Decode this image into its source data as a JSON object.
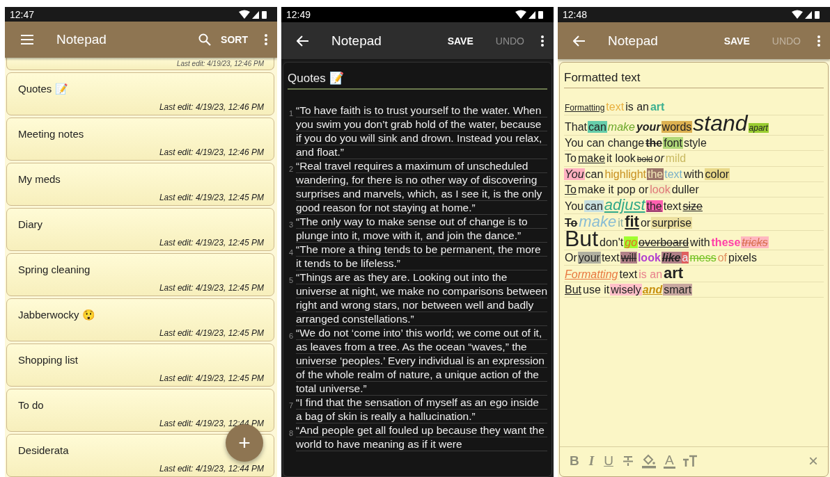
{
  "screens": [
    {
      "kind": "list",
      "time": "12:47",
      "title": "Notepad",
      "actions": [
        "SORT"
      ],
      "partial_note": {
        "date": "Last edit: 4/19/23, 12:46 PM"
      },
      "notes": [
        {
          "title": "Quotes 📝",
          "date": "Last edit: 4/19/23, 12:46 PM"
        },
        {
          "title": "Meeting notes",
          "date": "Last edit: 4/19/23, 12:46 PM"
        },
        {
          "title": "My meds",
          "date": "Last edit: 4/19/23, 12:45 PM"
        },
        {
          "title": "Diary",
          "date": "Last edit: 4/19/23, 12:45 PM"
        },
        {
          "title": "Spring cleaning",
          "date": "Last edit: 4/19/23, 12:45 PM"
        },
        {
          "title": "Jabberwocky 😲",
          "date": "Last edit: 4/19/23, 12:45 PM"
        },
        {
          "title": "Shopping list",
          "date": "Last edit: 4/19/23, 12:45 PM"
        },
        {
          "title": "To do",
          "date": "Last edit: 4/19/23, 12:44 PM"
        },
        {
          "title": "Desiderata",
          "date": "Last edit: 4/19/23, 12:44 PM"
        }
      ],
      "fab": "+"
    },
    {
      "kind": "quotes",
      "time": "12:49",
      "title": "Notepad",
      "actions": [
        {
          "label": "SAVE",
          "disabled": false
        },
        {
          "label": "UNDO",
          "disabled": true
        }
      ],
      "note_title": "Quotes 📝",
      "paragraphs": [
        {
          "number": "1",
          "text": "“To have faith is to trust yourself to the water. When you swim you don’t grab hold of the water, because if you do you will sink and drown. Instead you relax, and float.”"
        },
        {
          "number": "2",
          "text": "“Real travel requires a maximum of unscheduled wandering, for there is no other way of discovering surprises and marvels, which, as I see it, is the only good reason for not staying at home.”"
        },
        {
          "number": "3",
          "text": "“The only way to make sense out of change is to plunge into it, move with it, and join the dance.”"
        },
        {
          "number": "4",
          "text": "“The more a thing tends to be permanent, the more it tends to be lifeless.”"
        },
        {
          "number": "5",
          "text": "“Things are as they are. Looking out into the universe at night, we make no comparisons between right and wrong stars, nor between well and badly arranged constellations.”"
        },
        {
          "number": "6",
          "text": "“We do not ‘come into’ this world; we come out of it, as leaves from a tree. As the ocean “waves,” the universe ‘peoples.’ Every individual is an expression of the whole realm of nature, a unique action of the total universe.”"
        },
        {
          "number": "7",
          "text": "“I find that the sensation of myself as an ego inside a bag of skin is really a hallucination.”"
        },
        {
          "number": "8",
          "text": "“And people get all fouled up because they want the world to have meaning as if it were"
        }
      ]
    },
    {
      "kind": "formatted",
      "time": "12:48",
      "title": "Notepad",
      "actions": [
        {
          "label": "SAVE",
          "disabled": false
        },
        {
          "label": "UNDO",
          "disabled": true
        }
      ],
      "note_title": "Formatted text",
      "lines": [
        [
          "Formatting",
          "text",
          "is an",
          "art"
        ],
        [
          "That",
          "can",
          "make",
          "your",
          "words",
          "stand",
          "apart"
        ],
        [
          "You can change",
          "the",
          "font",
          "style"
        ],
        [
          "To",
          "make",
          "it look",
          "bold",
          "or",
          "mild"
        ],
        [
          "You",
          "can",
          "highlight",
          "the",
          "text",
          "with",
          "color"
        ],
        [
          "To",
          "make it pop or",
          "look",
          "duller"
        ],
        [
          "You",
          "can",
          "adjust",
          "the",
          "text",
          "size"
        ],
        [
          "To",
          "make",
          "it",
          "fit",
          "or",
          "surprise"
        ],
        [
          "But",
          "don't",
          "go",
          "overboard",
          "with",
          "these",
          "tricks"
        ],
        [
          "Or",
          "your",
          "text",
          "will",
          "look",
          "like",
          "a",
          "mess",
          "of",
          "pixels"
        ],
        [
          "Formatting",
          "text",
          "is an",
          "art"
        ],
        [
          "But",
          "use it",
          "wisely",
          "and",
          "smart"
        ]
      ],
      "toolbar": [
        {
          "kind": "bold",
          "label": "B"
        },
        {
          "kind": "italic",
          "label": "I"
        },
        {
          "kind": "underline",
          "label": "U"
        },
        {
          "kind": "strike"
        },
        {
          "kind": "fill"
        },
        {
          "kind": "color",
          "label": "A"
        },
        {
          "kind": "size"
        }
      ],
      "close": "×"
    }
  ]
}
